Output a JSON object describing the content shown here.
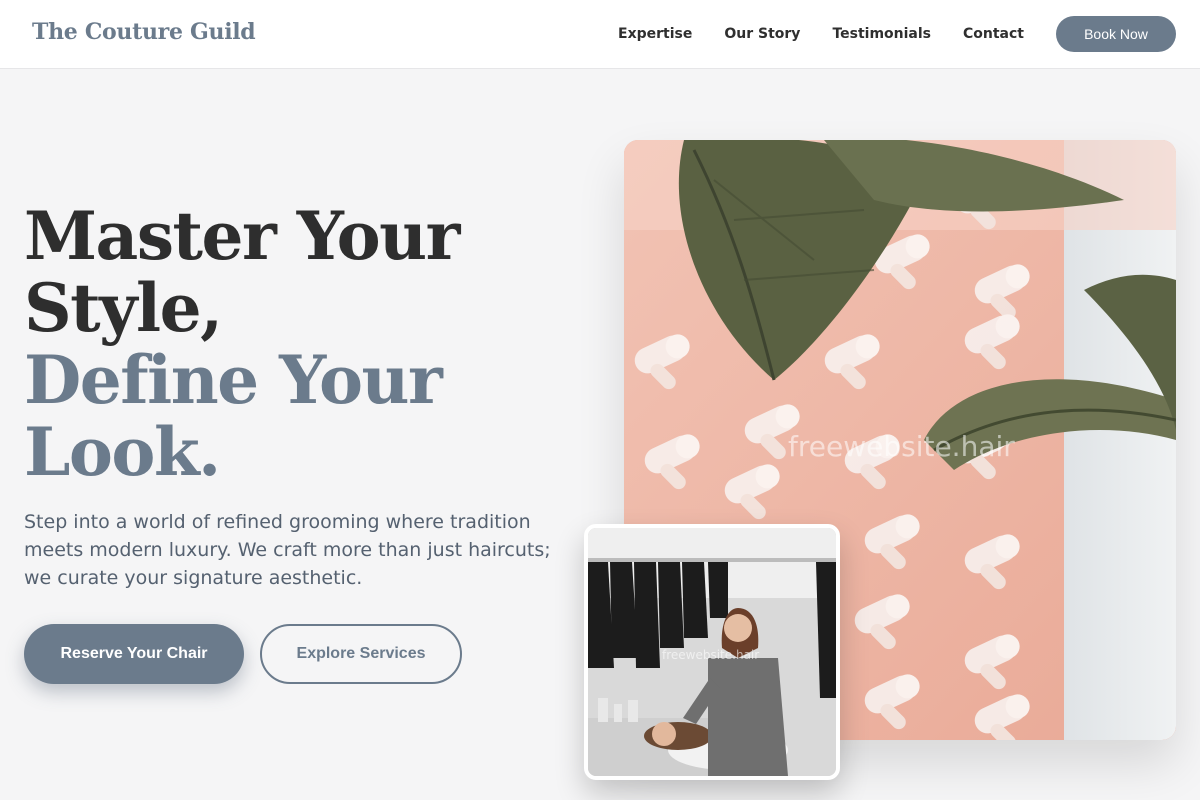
{
  "header": {
    "logo": "The Couture Guild",
    "nav": [
      "Expertise",
      "Our Story",
      "Testimonials",
      "Contact"
    ],
    "cta": "Book Now"
  },
  "hero": {
    "title_lines": [
      "Master Your",
      "Style,",
      "Define Your",
      "Look."
    ],
    "subtitle": "Step into a world of refined grooming where tradition meets modern luxury. We craft more than just haircuts; we curate your signature aesthetic.",
    "primary_button": "Reserve Your Chair",
    "secondary_button": "Explore Services"
  },
  "images": {
    "main_watermark": "freewebsite.hair",
    "inset_watermark": "freewebsite.hair"
  },
  "colors": {
    "accent": "#6b7b8c",
    "background": "#f5f5f6",
    "dark_text": "#2e2e2e"
  }
}
